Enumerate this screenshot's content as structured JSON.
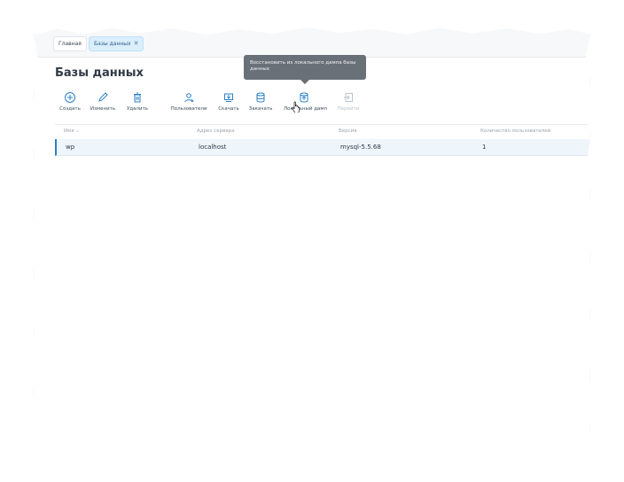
{
  "breadcrumbs": [
    {
      "label": "Главная"
    },
    {
      "label": "Базы данных",
      "close_icon": "close-icon"
    }
  ],
  "page_title": "Базы данных",
  "toolbar": [
    {
      "label": "Создать",
      "icon": "plus-circle-icon",
      "enabled": true
    },
    {
      "label": "Изменить",
      "icon": "pencil-icon",
      "enabled": true
    },
    {
      "label": "Удалить",
      "icon": "trash-icon",
      "enabled": true
    },
    {
      "label": "Пользователи",
      "icon": "users-icon",
      "enabled": true
    },
    {
      "label": "Скачать",
      "icon": "download-icon",
      "enabled": true
    },
    {
      "label": "Закачать",
      "icon": "upload-icon",
      "enabled": true
    },
    {
      "label": "Локальный дамп",
      "icon": "local-dump-icon",
      "enabled": true
    },
    {
      "label": "Перейти",
      "icon": "go-to-icon",
      "enabled": false
    }
  ],
  "tooltip": {
    "text": "Восстановить из локального дампа базы данных"
  },
  "table": {
    "columns": [
      "Имя",
      "Адрес сервера",
      "Версия",
      "Количество пользователей"
    ],
    "sort_column": "Имя",
    "rows": [
      {
        "name": "wp",
        "server": "localhost",
        "version": "mysql-5.5.68",
        "users": "1"
      }
    ]
  },
  "colors": {
    "accent": "#2a7fc6",
    "selected_row": "#eef6fc",
    "tooltip_bg": "#6a7078",
    "disabled": "#b8c4cf"
  }
}
